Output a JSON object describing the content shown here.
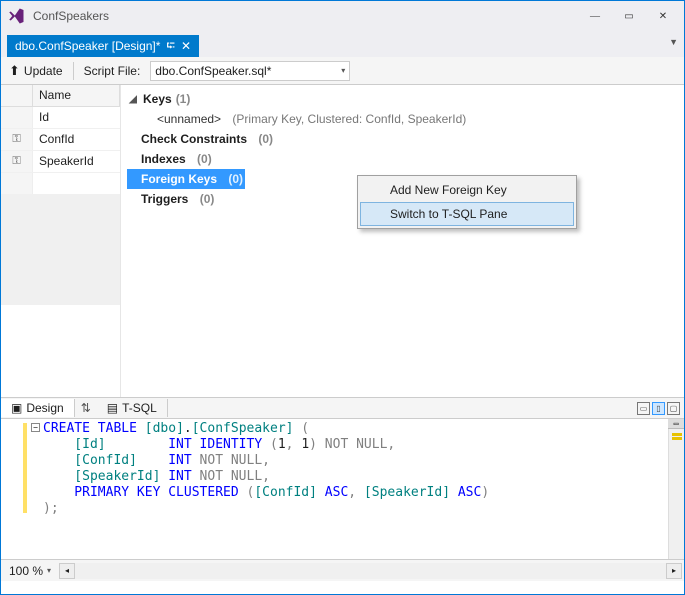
{
  "titlebar": {
    "app_name": "ConfSpeakers"
  },
  "window_buttons": {
    "min": "—",
    "max": "▭",
    "close": "✕"
  },
  "tab": {
    "label": "dbo.ConfSpeaker [Design]*",
    "pin": "⮓",
    "close": "✕"
  },
  "toolbar": {
    "update_label": "Update",
    "script_file_label": "Script File:",
    "script_file_value": "dbo.ConfSpeaker.sql*"
  },
  "columns_grid": {
    "header_name": "Name",
    "rows": [
      {
        "icon": "",
        "name": "Id"
      },
      {
        "icon": "key",
        "name": "ConfId"
      },
      {
        "icon": "key",
        "name": "SpeakerId"
      }
    ]
  },
  "tree": {
    "keys": {
      "label": "Keys",
      "count": "(1)"
    },
    "keys_child": {
      "label": "<unnamed>",
      "detail": "(Primary Key, Clustered: ConfId, SpeakerId)"
    },
    "check": {
      "label": "Check Constraints",
      "count": "(0)"
    },
    "indexes": {
      "label": "Indexes",
      "count": "(0)"
    },
    "fk": {
      "label": "Foreign Keys",
      "count": "(0)"
    },
    "triggers": {
      "label": "Triggers",
      "count": "(0)"
    }
  },
  "context_menu": {
    "item1": "Add New Foreign Key",
    "item2": "Switch to T-SQL Pane"
  },
  "pane_tabs": {
    "design": "Design",
    "tsql": "T-SQL"
  },
  "code": {
    "l1a": "CREATE",
    "l1b": " TABLE ",
    "l1c": "[dbo]",
    "l1d": ".",
    "l1e": "[ConfSpeaker]",
    "l1f": " (",
    "l2a": "    [Id]        ",
    "l2b": "INT",
    "l2c": " IDENTITY ",
    "l2d": "(",
    "l2e": "1",
    "l2f": ", ",
    "l2g": "1",
    "l2h": ")",
    "l2i": " NOT NULL,",
    "l3a": "    [ConfId]    ",
    "l3b": "INT",
    "l3c": " NOT NULL,",
    "l4a": "    [SpeakerId] ",
    "l4b": "INT",
    "l4c": " NOT NULL,",
    "l5a": "    PRIMARY",
    "l5b": " KEY ",
    "l5c": "CLUSTERED ",
    "l5d": "(",
    "l5e": "[ConfId]",
    "l5f": " ASC",
    "l5g": ", ",
    "l5h": "[SpeakerId]",
    "l5i": " ASC",
    "l5j": ")",
    "l6": ");"
  },
  "statusbar": {
    "zoom": "100 %"
  }
}
